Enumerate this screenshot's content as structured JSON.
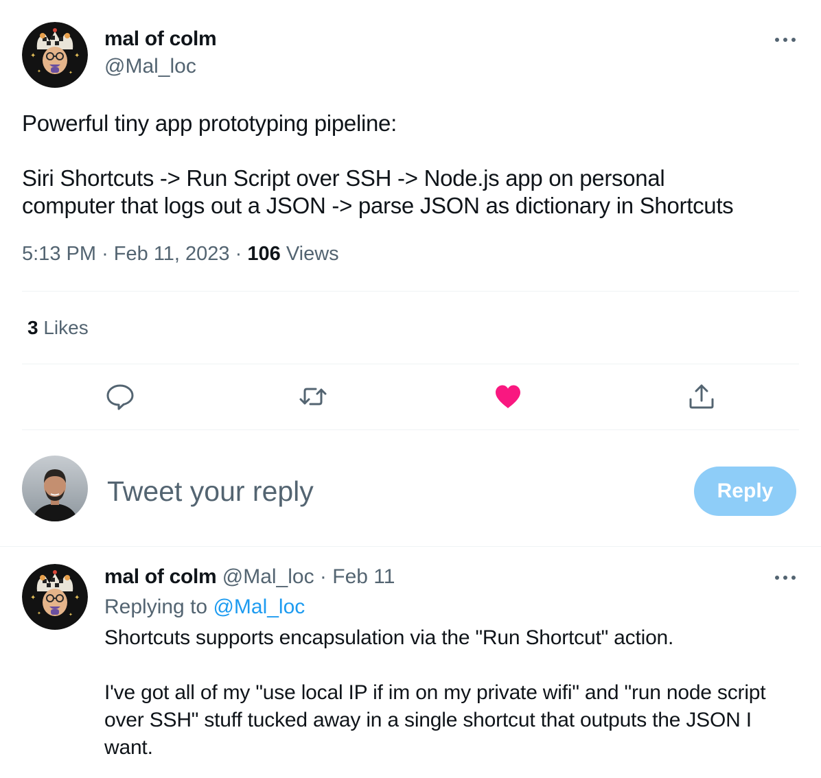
{
  "tweet": {
    "author": {
      "name": "mal of colm",
      "handle": "@Mal_loc",
      "avatar_icon": "jester-avatar-icon"
    },
    "more_icon": "more-dots-icon",
    "text_line1": "Powerful tiny app prototyping pipeline:",
    "text_line2": "Siri Shortcuts -> Run Script over SSH -> Node.js app on personal",
    "text_line3": "computer that logs out a JSON -> parse JSON as dictionary in Shortcuts",
    "time": "5:13 PM",
    "date": "Feb 11, 2023",
    "dot": "·",
    "views_count": "106",
    "views_label": "Views",
    "likes_count": "3",
    "likes_label": "Likes",
    "liked": true
  },
  "actions": {
    "reply_icon": "reply-bubble-icon",
    "retweet_icon": "retweet-icon",
    "like_icon": "heart-filled-icon",
    "share_icon": "share-upload-icon",
    "like_color": "#f91880",
    "icon_color": "#536471"
  },
  "composer": {
    "placeholder": "Tweet your reply",
    "button_label": "Reply",
    "button_color": "#8ecdf8"
  },
  "reply": {
    "author": {
      "name": "mal of colm",
      "handle": "@Mal_loc",
      "date": "Feb 11",
      "avatar_icon": "jester-avatar-icon"
    },
    "replying_label": "Replying to",
    "replying_mention": "@Mal_loc",
    "text_line1": "Shortcuts supports encapsulation via the \"Run Shortcut\" action.",
    "text_line2": "I've got all of my \"use local IP if im on my private wifi\" and \"run node script",
    "text_line3": "over SSH\" stuff tucked away in a single shortcut that outputs the JSON I",
    "text_line4": "want."
  },
  "colors": {
    "text_primary": "#0f1419",
    "text_secondary": "#536471",
    "link": "#1d9bf0",
    "divider": "#eff3f4"
  }
}
